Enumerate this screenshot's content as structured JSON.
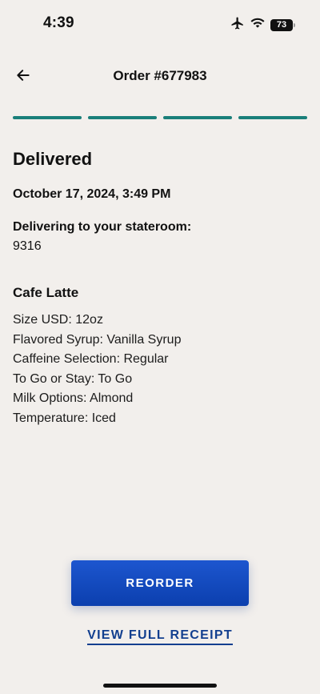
{
  "status_bar": {
    "time": "4:39",
    "battery": "73",
    "icons": [
      "airplane-icon",
      "wifi-icon",
      "battery-icon"
    ]
  },
  "header": {
    "title": "Order #677983",
    "back_icon": "arrow-left-icon"
  },
  "progress": {
    "steps_total": 4,
    "steps_completed": 4,
    "color": "#1a7f7a"
  },
  "order": {
    "status": "Delivered",
    "date": "October 17, 2024, 3:49 PM",
    "delivery_label": "Delivering to your stateroom:",
    "stateroom": "9316"
  },
  "item": {
    "name": "Cafe Latte",
    "options": [
      "Size USD: 12oz",
      "Flavored Syrup: Vanilla Syrup",
      "Caffeine Selection: Regular",
      "To Go or Stay: To Go",
      "Milk Options: Almond",
      "Temperature: Iced"
    ]
  },
  "actions": {
    "reorder_label": "REORDER",
    "receipt_label": "VIEW FULL RECEIPT",
    "accent_color": "#0b3fae"
  }
}
